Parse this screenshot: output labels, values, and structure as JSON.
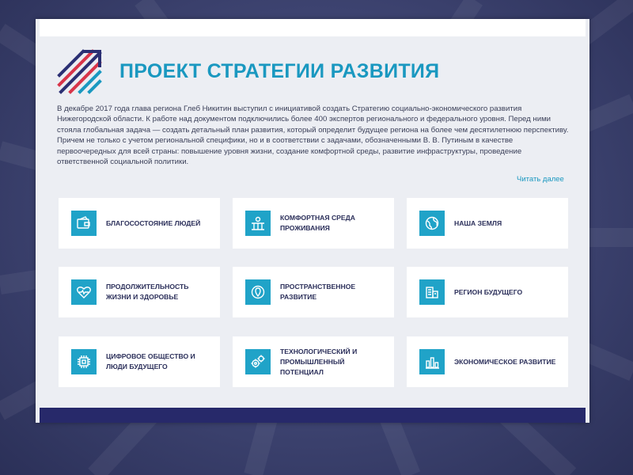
{
  "page": {
    "title": "ПРОЕКТ СТРАТЕГИИ РАЗВИТИЯ",
    "intro": "В декабре 2017 года глава региона Глеб Никитин выступил с инициативой создать Стратегию социально-экономического развития Нижегородской области. К работе над документом подключились более 400 экспертов регионального и федерального уровня. Перед ними стояла глобальная задача — создать детальный план развития, который определит будущее региона на более чем десятилетнюю перспективу. Причем не только с учетом региональной специфики, но и в соответствии с задачами, обозначенными В. В. Путиным в качестве первоочередных для всей страны: повышение уровня жизни, создание комфортной среды, развитие инфраструктуры, проведение ответственной социальной политики.",
    "read_more": "Читать далее"
  },
  "cards": [
    {
      "label": "Благосостояние людей",
      "icon": "wallet-icon"
    },
    {
      "label": "Комфортная среда проживания",
      "icon": "city-icon"
    },
    {
      "label": "Наша земля",
      "icon": "globe-icon"
    },
    {
      "label": "Продолжительность жизни и здоровье",
      "icon": "heart-pulse-icon"
    },
    {
      "label": "Пространственное развитие",
      "icon": "location-icon"
    },
    {
      "label": "Регион будущего",
      "icon": "building-icon"
    },
    {
      "label": "Цифровое общество и люди будущего",
      "icon": "chip-icon"
    },
    {
      "label": "Технологический и промышленный потенциал",
      "icon": "gears-icon"
    },
    {
      "label": "Экономическое развитие",
      "icon": "bar-chart-icon"
    }
  ],
  "colors": {
    "accent": "#1a98c0",
    "icon_bg": "#20a3c8",
    "text_dark": "#2b2f5a",
    "footer": "#27296a",
    "logo_red": "#d8354a",
    "logo_navy": "#2b2f73"
  }
}
